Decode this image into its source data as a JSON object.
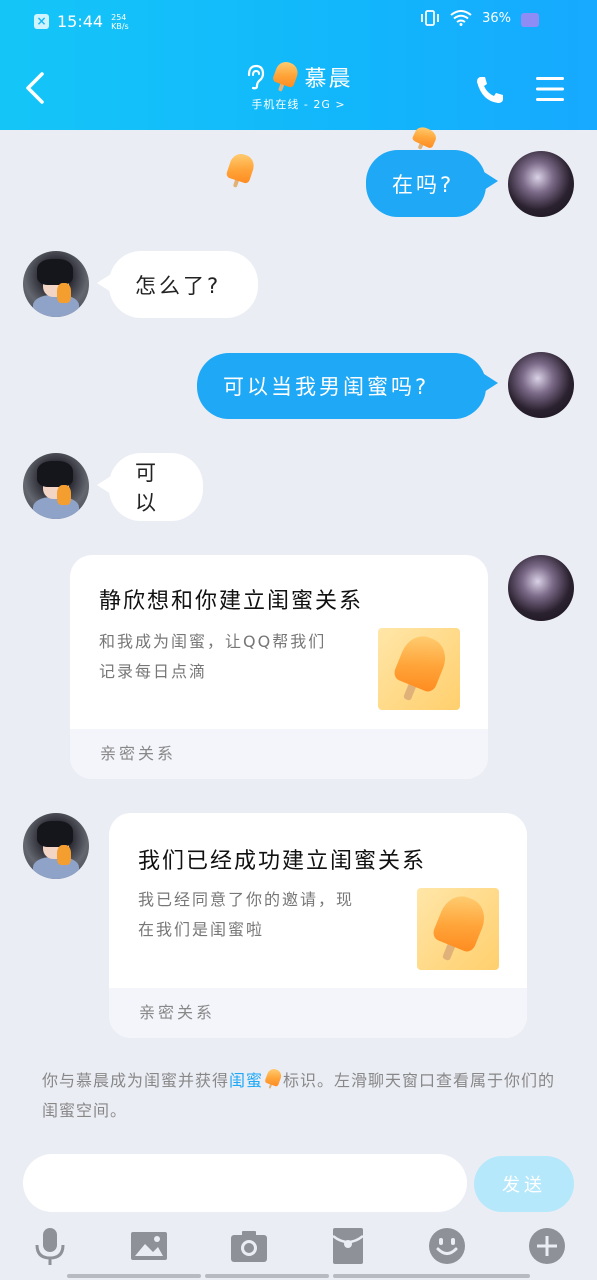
{
  "status_bar": {
    "time": "15:44",
    "net_speed_top": "254",
    "net_speed_bottom": "KB/s",
    "battery": "36%"
  },
  "header": {
    "title": "慕晨",
    "subtitle": "手机在线 - 2G >",
    "icons": [
      "back-arrow-icon",
      "ear-icon",
      "popsicle-icon",
      "phone-icon",
      "menu-icon"
    ]
  },
  "messages": [
    {
      "side": "me",
      "text": "在吗?"
    },
    {
      "side": "other",
      "text": "怎么了?"
    },
    {
      "side": "me",
      "text": "可以当我男闺蜜吗?"
    },
    {
      "side": "other",
      "text": "可以"
    }
  ],
  "cards": [
    {
      "side": "me",
      "title": "静欣想和你建立闺蜜关系",
      "desc": [
        "和我成为闺蜜，让QQ帮我们",
        "记录每日点滴"
      ],
      "footer": "亲密关系"
    },
    {
      "side": "other",
      "title": "我们已经成功建立闺蜜关系",
      "desc": [
        "我已经同意了你的邀请，现",
        "在我们是闺蜜啦"
      ],
      "footer": "亲密关系"
    }
  ],
  "notice": {
    "prefix": "你与慕晨成为闺蜜并获得",
    "link": "闺蜜",
    "suffix": "标识。左滑聊天窗口查看属于你们的闺蜜空间。"
  },
  "composer": {
    "placeholder": "",
    "send_label": "发送"
  },
  "toolbar": [
    "microphone-icon",
    "image-icon",
    "camera-icon",
    "red-packet-icon",
    "emoji-icon",
    "plus-icon"
  ],
  "colors": {
    "header_gradient_start": "#14c6f8",
    "header_gradient_end": "#17a9ff",
    "my_bubble": "#1ea8f5",
    "background": "#ebedf5"
  }
}
